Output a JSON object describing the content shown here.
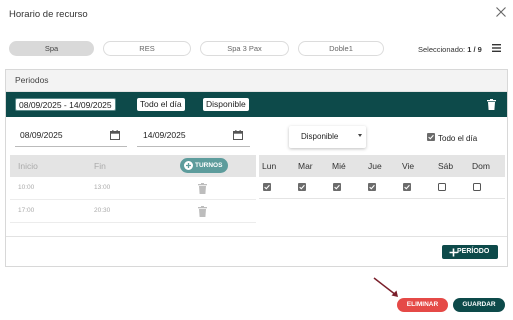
{
  "modal": {
    "title": "Horario de recurso"
  },
  "resources": {
    "chips": [
      {
        "label": "Spa",
        "active": true
      },
      {
        "label": "RES",
        "active": false
      },
      {
        "label": "Spa 3 Pax",
        "active": false
      },
      {
        "label": "Doble1",
        "active": false
      }
    ],
    "selected_label": "Seleccionado:",
    "selected_value": "1 / 9"
  },
  "periods": {
    "header": "Periodos",
    "band": {
      "range": "08/09/2025 - 14/09/2025",
      "all_day": "Todo el día",
      "status": "Disponible"
    },
    "form": {
      "start_date": "08/09/2025",
      "end_date": "14/09/2025",
      "availability": "Disponible",
      "all_day_label": "Todo el día",
      "all_day_checked": true
    },
    "times": {
      "start_header": "Inicio",
      "end_header": "Fin",
      "turnos_label": "TURNOS",
      "rows": [
        {
          "start": "10:00",
          "end": "13:00"
        },
        {
          "start": "17:00",
          "end": "20:30"
        }
      ]
    },
    "days": [
      {
        "label": "Lun",
        "checked": true
      },
      {
        "label": "Mar",
        "checked": true
      },
      {
        "label": "Mié",
        "checked": true
      },
      {
        "label": "Jue",
        "checked": true
      },
      {
        "label": "Vie",
        "checked": true
      },
      {
        "label": "Sáb",
        "checked": false
      },
      {
        "label": "Dom",
        "checked": false
      }
    ],
    "add_period_label": "PERÍODO"
  },
  "footer": {
    "delete_label": "ELIMINAR",
    "save_label": "GUARDAR"
  },
  "colors": {
    "primary": "#0d4a4a",
    "danger": "#e54a47",
    "accent": "#5d9c9c",
    "arrow": "#7a1f2b"
  },
  "icons": {
    "close": "close-icon",
    "menu": "menu-icon",
    "calendar": "calendar-icon",
    "trash": "trash-icon",
    "plus": "plus-icon",
    "checkbox": "checkbox-icon"
  }
}
